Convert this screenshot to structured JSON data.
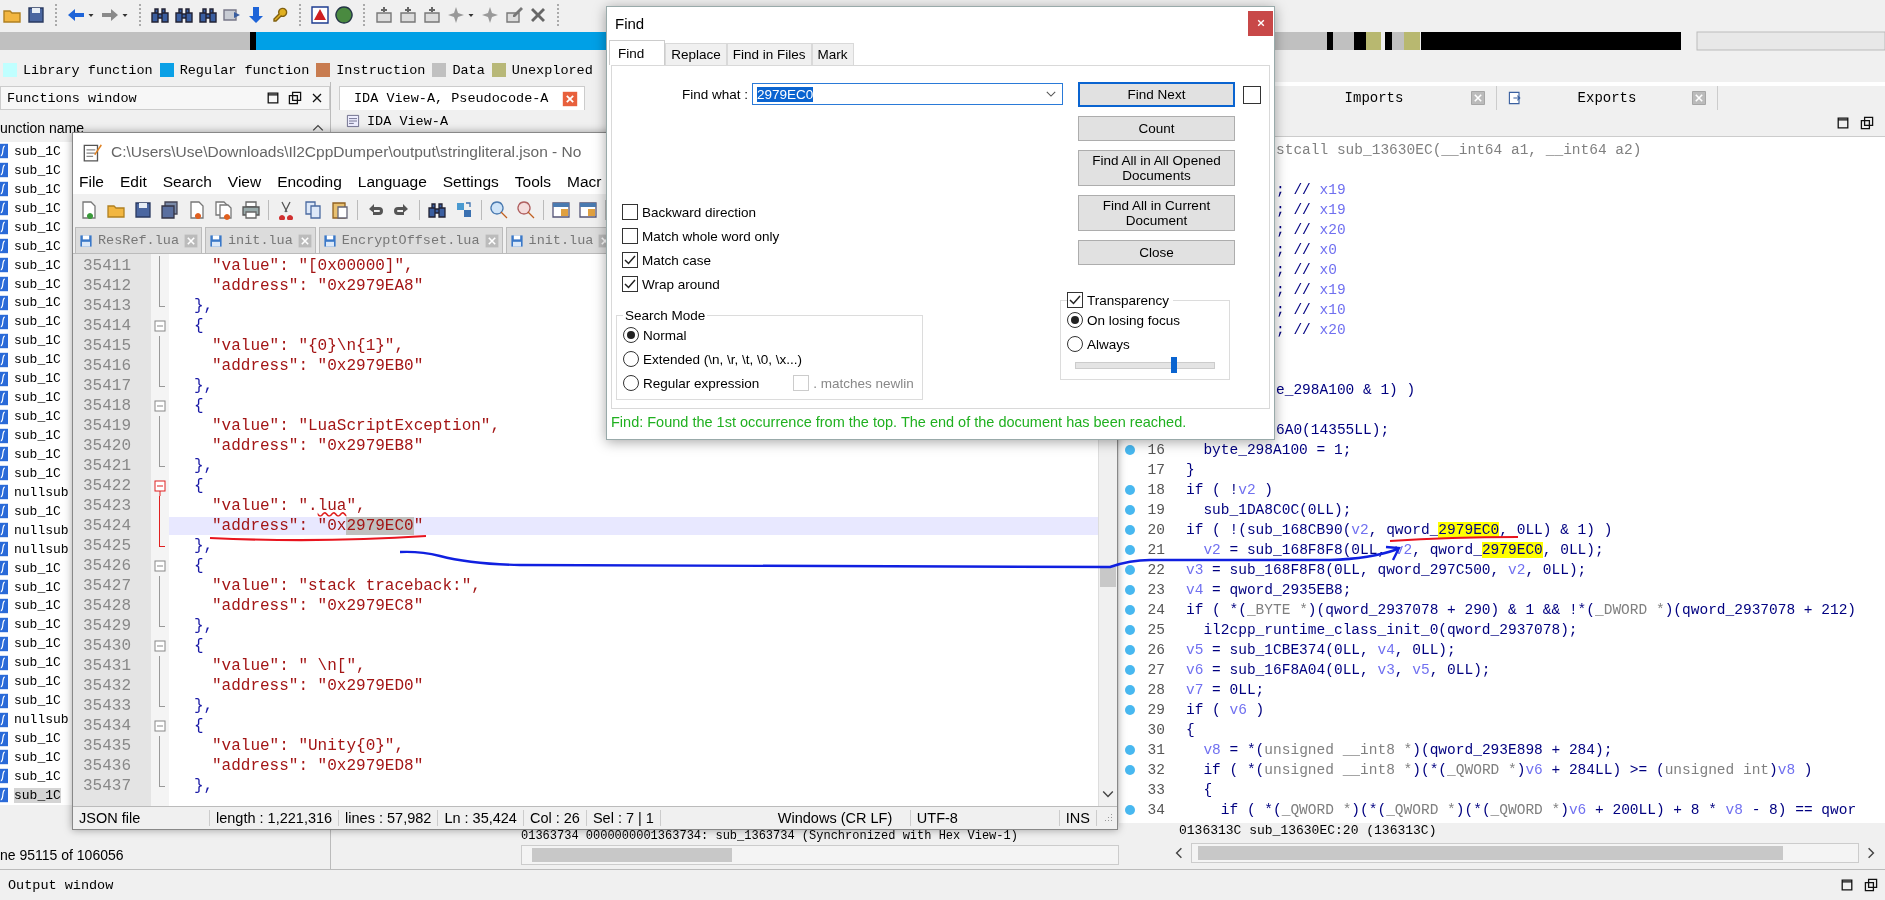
{
  "ida": {
    "legend": [
      {
        "label": "Library function",
        "color": "#c0ffff"
      },
      {
        "label": "Regular function",
        "color": "#0aa0e6"
      },
      {
        "label": "Instruction",
        "color": "#c87c50"
      },
      {
        "label": "Data",
        "color": "#c0c0c0"
      },
      {
        "label": "Unexplored",
        "color": "#b8b878"
      }
    ],
    "functions_window": {
      "title": "Functions window",
      "header": "unction name",
      "items": [
        {
          "name": "sub_1C",
          "selected": false
        },
        {
          "name": "sub_1C",
          "selected": false
        },
        {
          "name": "sub_1C",
          "selected": false
        },
        {
          "name": "sub_1C",
          "selected": false
        },
        {
          "name": "sub_1C",
          "selected": false
        },
        {
          "name": "sub_1C",
          "selected": false
        },
        {
          "name": "sub_1C",
          "selected": false
        },
        {
          "name": "sub_1C",
          "selected": false
        },
        {
          "name": "sub_1C",
          "selected": false
        },
        {
          "name": "sub_1C",
          "selected": false
        },
        {
          "name": "sub_1C",
          "selected": false
        },
        {
          "name": "sub_1C",
          "selected": false
        },
        {
          "name": "sub_1C",
          "selected": false
        },
        {
          "name": "sub_1C",
          "selected": false
        },
        {
          "name": "sub_1C",
          "selected": false
        },
        {
          "name": "sub_1C",
          "selected": false
        },
        {
          "name": "sub_1C",
          "selected": false
        },
        {
          "name": "sub_1C",
          "selected": false
        },
        {
          "name": "nullsub",
          "selected": false
        },
        {
          "name": "sub_1C",
          "selected": false
        },
        {
          "name": "nullsub",
          "selected": false
        },
        {
          "name": "nullsub",
          "selected": false
        },
        {
          "name": "sub_1C",
          "selected": false
        },
        {
          "name": "sub_1C",
          "selected": false
        },
        {
          "name": "sub_1C",
          "selected": false
        },
        {
          "name": "sub_1C",
          "selected": false
        },
        {
          "name": "sub_1C",
          "selected": false
        },
        {
          "name": "sub_1C",
          "selected": false
        },
        {
          "name": "sub_1C",
          "selected": false
        },
        {
          "name": "sub_1C",
          "selected": false
        },
        {
          "name": "nullsub",
          "selected": false
        },
        {
          "name": "sub_1C",
          "selected": false
        },
        {
          "name": "sub_1C",
          "selected": false
        },
        {
          "name": "sub_1C",
          "selected": false
        },
        {
          "name": "sub_1C",
          "selected": true
        }
      ],
      "status": "ne 95115 of 106056"
    },
    "view_tab": "IDA View-A, Pseudocode-A",
    "subview_tab": "IDA View-A",
    "sync_line": "01363734 0000000001363734: sub_1363734 (Synchronized with Hex View-1)",
    "side_tabs": [
      {
        "label": "Imports"
      },
      {
        "label": "Exports"
      }
    ],
    "pseudocode": {
      "lines": [
        {
          "kind": "tail",
          "parts": [
            {
              "text": "stcall sub_13630EC(__int64 a1, __int64 a2)",
              "kind": "type"
            }
          ]
        },
        {
          "kind": "covered"
        },
        {
          "kind": "tail",
          "parts": [
            {
              "text": "; // ",
              "kind": "plain"
            },
            {
              "text": "x19",
              "kind": "var"
            }
          ]
        },
        {
          "kind": "tail",
          "parts": [
            {
              "text": "; // ",
              "kind": "plain"
            },
            {
              "text": "x19",
              "kind": "var"
            }
          ]
        },
        {
          "kind": "tail",
          "parts": [
            {
              "text": "; // ",
              "kind": "plain"
            },
            {
              "text": "x20",
              "kind": "var"
            }
          ]
        },
        {
          "kind": "tail",
          "parts": [
            {
              "text": "; // ",
              "kind": "plain"
            },
            {
              "text": "x0",
              "kind": "var"
            }
          ]
        },
        {
          "kind": "tail",
          "parts": [
            {
              "text": "; // ",
              "kind": "plain"
            },
            {
              "text": "x0",
              "kind": "var"
            }
          ]
        },
        {
          "kind": "tail",
          "parts": [
            {
              "text": "; // ",
              "kind": "plain"
            },
            {
              "text": "x19",
              "kind": "var"
            }
          ]
        },
        {
          "kind": "tail",
          "parts": [
            {
              "text": "; // ",
              "kind": "plain"
            },
            {
              "text": "x10",
              "kind": "var"
            }
          ]
        },
        {
          "kind": "tail",
          "parts": [
            {
              "text": "; // ",
              "kind": "plain"
            },
            {
              "text": "x20",
              "kind": "var"
            }
          ]
        },
        {
          "kind": "covered"
        },
        {
          "kind": "covered"
        },
        {
          "kind": "tail",
          "parts": [
            {
              "text": "e_298A100 & 1) )",
              "kind": "plain"
            }
          ]
        },
        {
          "kind": "covered"
        },
        {
          "kind": "tail",
          "parts": [
            {
              "text": "6A0(14355LL);",
              "kind": "plain"
            }
          ]
        },
        {
          "kind": "line",
          "number": "16",
          "marker": true,
          "parts": [
            {
              "text": "  byte_298A100 = 1;",
              "kind": "plain"
            }
          ]
        },
        {
          "kind": "line",
          "number": "17",
          "marker": false,
          "parts": [
            {
              "text": "}",
              "kind": "plain"
            }
          ]
        },
        {
          "kind": "line",
          "number": "18",
          "marker": true,
          "parts": [
            {
              "text": "if ( !",
              "kind": "plain"
            },
            {
              "text": "v2",
              "kind": "var"
            },
            {
              "text": " )",
              "kind": "plain"
            }
          ]
        },
        {
          "kind": "line",
          "number": "19",
          "marker": true,
          "parts": [
            {
              "text": "  sub_1DA8C0C(0LL);",
              "kind": "plain"
            }
          ]
        },
        {
          "kind": "line",
          "number": "20",
          "marker": true,
          "parts": [
            {
              "text": "if ( !(sub_168CB90(",
              "kind": "plain"
            },
            {
              "text": "v2",
              "kind": "var"
            },
            {
              "text": ", qword_",
              "kind": "plain"
            },
            {
              "text": "2979EC0",
              "kind": "hl"
            },
            {
              "text": ", 0LL) & 1) )",
              "kind": "plain"
            }
          ]
        },
        {
          "kind": "line",
          "number": "21",
          "marker": true,
          "parts": [
            {
              "text": "  v2",
              "kind": "var"
            },
            {
              "text": " = sub_168F8F8(0LL, ",
              "kind": "plain"
            },
            {
              "text": "v2",
              "kind": "var"
            },
            {
              "text": ", qword_",
              "kind": "plain"
            },
            {
              "text": "2979EC0",
              "kind": "hl"
            },
            {
              "text": ", 0LL);",
              "kind": "plain"
            }
          ]
        },
        {
          "kind": "line",
          "number": "22",
          "marker": true,
          "parts": [
            {
              "text": "v3",
              "kind": "var"
            },
            {
              "text": " = sub_168F8F8(0LL, qword_297C500, ",
              "kind": "plain"
            },
            {
              "text": "v2",
              "kind": "var"
            },
            {
              "text": ", 0LL);",
              "kind": "plain"
            }
          ]
        },
        {
          "kind": "line",
          "number": "23",
          "marker": true,
          "parts": [
            {
              "text": "v4",
              "kind": "var"
            },
            {
              "text": " = qword_2935EB8;",
              "kind": "plain"
            }
          ]
        },
        {
          "kind": "line",
          "number": "24",
          "marker": true,
          "parts": [
            {
              "text": "if ( *(",
              "kind": "plain"
            },
            {
              "text": "_BYTE *",
              "kind": "type"
            },
            {
              "text": ")(qword_2937078 + 290) & 1 && !*(",
              "kind": "plain"
            },
            {
              "text": "_DWORD *",
              "kind": "type"
            },
            {
              "text": ")(qword_2937078 + 212)",
              "kind": "plain"
            }
          ]
        },
        {
          "kind": "line",
          "number": "25",
          "marker": true,
          "parts": [
            {
              "text": "  il2cpp_runtime_class_init_0(qword_2937078);",
              "kind": "plain"
            }
          ]
        },
        {
          "kind": "line",
          "number": "26",
          "marker": true,
          "parts": [
            {
              "text": "v5",
              "kind": "var"
            },
            {
              "text": " = sub_1CBE374(0LL, ",
              "kind": "plain"
            },
            {
              "text": "v4",
              "kind": "var"
            },
            {
              "text": ", 0LL);",
              "kind": "plain"
            }
          ]
        },
        {
          "kind": "line",
          "number": "27",
          "marker": true,
          "parts": [
            {
              "text": "v6",
              "kind": "var"
            },
            {
              "text": " = sub_16F8A04(0LL, ",
              "kind": "plain"
            },
            {
              "text": "v3",
              "kind": "var"
            },
            {
              "text": ", ",
              "kind": "plain"
            },
            {
              "text": "v5",
              "kind": "var"
            },
            {
              "text": ", 0LL);",
              "kind": "plain"
            }
          ]
        },
        {
          "kind": "line",
          "number": "28",
          "marker": true,
          "parts": [
            {
              "text": "v7",
              "kind": "var"
            },
            {
              "text": " = 0LL;",
              "kind": "plain"
            }
          ]
        },
        {
          "kind": "line",
          "number": "29",
          "marker": true,
          "parts": [
            {
              "text": "if ( ",
              "kind": "plain"
            },
            {
              "text": "v6",
              "kind": "var"
            },
            {
              "text": " )",
              "kind": "plain"
            }
          ]
        },
        {
          "kind": "line",
          "number": "30",
          "marker": false,
          "parts": [
            {
              "text": "{",
              "kind": "plain"
            }
          ]
        },
        {
          "kind": "line",
          "number": "31",
          "marker": true,
          "parts": [
            {
              "text": "  v8",
              "kind": "var"
            },
            {
              "text": " = *(",
              "kind": "plain"
            },
            {
              "text": "unsigned __int8 *",
              "kind": "type"
            },
            {
              "text": ")(qword_293E898 + 284);",
              "kind": "plain"
            }
          ]
        },
        {
          "kind": "line",
          "number": "32",
          "marker": true,
          "parts": [
            {
              "text": "  if ( *(",
              "kind": "plain"
            },
            {
              "text": "unsigned __int8 *",
              "kind": "type"
            },
            {
              "text": ")(*(",
              "kind": "plain"
            },
            {
              "text": "_QWORD *",
              "kind": "type"
            },
            {
              "text": ")",
              "kind": "plain"
            },
            {
              "text": "v6",
              "kind": "var"
            },
            {
              "text": " + 284LL) >= (",
              "kind": "plain"
            },
            {
              "text": "unsigned int",
              "kind": "type"
            },
            {
              "text": ")",
              "kind": "plain"
            },
            {
              "text": "v8",
              "kind": "var"
            },
            {
              "text": " )",
              "kind": "plain"
            }
          ]
        },
        {
          "kind": "line",
          "number": "33",
          "marker": false,
          "parts": [
            {
              "text": "  {",
              "kind": "plain"
            }
          ]
        },
        {
          "kind": "line",
          "number": "34",
          "marker": true,
          "parts": [
            {
              "text": "    if ( *(",
              "kind": "plain"
            },
            {
              "text": "_QWORD *",
              "kind": "type"
            },
            {
              "text": ")(*(",
              "kind": "plain"
            },
            {
              "text": "_QWORD *",
              "kind": "type"
            },
            {
              "text": ")(*(",
              "kind": "plain"
            },
            {
              "text": "_QWORD *",
              "kind": "type"
            },
            {
              "text": ")",
              "kind": "plain"
            },
            {
              "text": "v6",
              "kind": "var"
            },
            {
              "text": " + 200LL) + 8 * ",
              "kind": "plain"
            },
            {
              "text": "v8",
              "kind": "var"
            },
            {
              "text": " - 8) == qwor",
              "kind": "plain"
            }
          ]
        }
      ],
      "status": "0136313C sub_13630EC:20 (136313C)"
    },
    "output_window": {
      "title": "Output window"
    }
  },
  "notepad": {
    "title": "C:\\Users\\Use\\Downloads\\Il2CppDumper\\output\\stringliteral.json - No",
    "menu": [
      "File",
      "Edit",
      "Search",
      "View",
      "Encoding",
      "Language",
      "Settings",
      "Tools",
      "Macr"
    ],
    "tabs": [
      {
        "label": "ResRef.lua",
        "selected": false
      },
      {
        "label": "init.lua",
        "selected": false
      },
      {
        "label": "EncryptOffset.lua",
        "selected": false
      },
      {
        "label": "init.lua",
        "selected": false
      }
    ],
    "lines": [
      {
        "number": "35411",
        "kind": "pair",
        "fold_active": false,
        "current": false,
        "text": "\"value\": \"[0x00000]\","
      },
      {
        "number": "35412",
        "kind": "pair",
        "fold_active": false,
        "current": false,
        "text": "\"address\": \"0x2979EA8\""
      },
      {
        "number": "35413",
        "kind": "close",
        "fold_active": false,
        "current": false,
        "text": "},"
      },
      {
        "number": "35414",
        "kind": "open",
        "fold_active": false,
        "current": false,
        "text": "{"
      },
      {
        "number": "35415",
        "kind": "pair",
        "fold_active": false,
        "current": false,
        "text": "\"value\": \"{0}\\n{1}\","
      },
      {
        "number": "35416",
        "kind": "pair",
        "fold_active": false,
        "current": false,
        "text": "\"address\": \"0x2979EB0\""
      },
      {
        "number": "35417",
        "kind": "close",
        "fold_active": false,
        "current": false,
        "text": "},"
      },
      {
        "number": "35418",
        "kind": "open",
        "fold_active": false,
        "current": false,
        "text": "{"
      },
      {
        "number": "35419",
        "kind": "pair",
        "fold_active": false,
        "current": false,
        "text": "\"value\": \"LuaScriptException\","
      },
      {
        "number": "35420",
        "kind": "pair",
        "fold_active": false,
        "current": false,
        "text": "\"address\": \"0x2979EB8\""
      },
      {
        "number": "35421",
        "kind": "close",
        "fold_active": false,
        "current": false,
        "text": "},"
      },
      {
        "number": "35422",
        "kind": "open",
        "fold_active": true,
        "current": false,
        "text": "{"
      },
      {
        "number": "35423",
        "kind": "pair",
        "fold_active": true,
        "current": false,
        "parts": [
          {
            "text": "\"value\": \".",
            "kind": "plain"
          },
          {
            "text": "lua",
            "kind": "misspelled"
          },
          {
            "text": "\",",
            "kind": "plain"
          }
        ]
      },
      {
        "number": "35424",
        "kind": "pair",
        "fold_active": true,
        "current": true,
        "parts": [
          {
            "text": "\"address\": \"0x",
            "kind": "plain"
          },
          {
            "text": "2979EC0",
            "kind": "selection"
          },
          {
            "text": "\"",
            "kind": "plain"
          }
        ]
      },
      {
        "number": "35425",
        "kind": "close",
        "fold_active": true,
        "current": false,
        "text": "},"
      },
      {
        "number": "35426",
        "kind": "open",
        "fold_active": false,
        "current": false,
        "text": "{"
      },
      {
        "number": "35427",
        "kind": "pair",
        "fold_active": false,
        "current": false,
        "text": "\"value\": \"stack traceback:\","
      },
      {
        "number": "35428",
        "kind": "pair",
        "fold_active": false,
        "current": false,
        "text": "\"address\": \"0x2979EC8\""
      },
      {
        "number": "35429",
        "kind": "close",
        "fold_active": false,
        "current": false,
        "text": "},"
      },
      {
        "number": "35430",
        "kind": "open",
        "fold_active": false,
        "current": false,
        "text": "{"
      },
      {
        "number": "35431",
        "kind": "pair",
        "fold_active": false,
        "current": false,
        "text": "\"value\": \" \\n[\","
      },
      {
        "number": "35432",
        "kind": "pair",
        "fold_active": false,
        "current": false,
        "text": "\"address\": \"0x2979ED0\""
      },
      {
        "number": "35433",
        "kind": "close",
        "fold_active": false,
        "current": false,
        "text": "},"
      },
      {
        "number": "35434",
        "kind": "open",
        "fold_active": false,
        "current": false,
        "text": "{"
      },
      {
        "number": "35435",
        "kind": "pair",
        "fold_active": false,
        "current": false,
        "text": "\"value\": \"Unity{0}\","
      },
      {
        "number": "35436",
        "kind": "pair",
        "fold_active": false,
        "current": false,
        "text": "\"address\": \"0x2979ED8\""
      },
      {
        "number": "35437",
        "kind": "close",
        "fold_active": false,
        "current": false,
        "text": "},"
      }
    ],
    "status_bar": {
      "left": [
        "JSON file",
        "length : 1,221,316",
        "lines : 57,982",
        "Ln : 35,424",
        "Col : 26",
        "Sel : 7 | 1"
      ],
      "right": [
        "Windows (CR LF)",
        "UTF-8",
        "INS"
      ]
    }
  },
  "find_dialog": {
    "title": "Find",
    "tabs": [
      {
        "label": "Find",
        "selected": true
      },
      {
        "label": "Replace",
        "selected": false
      },
      {
        "label": "Find in Files",
        "selected": false
      },
      {
        "label": "Mark",
        "selected": false
      }
    ],
    "find_what": {
      "label": "Find what :",
      "value": "2979EC0"
    },
    "buttons": [
      {
        "label": "Find Next",
        "default": true
      },
      {
        "label": "Count",
        "default": false
      },
      {
        "label": "Find All in All Opened Documents",
        "default": false
      },
      {
        "label": "Find All in Current Document",
        "default": false
      },
      {
        "label": "Close",
        "default": false
      }
    ],
    "side_checkbox": {
      "checked": false
    },
    "options": [
      {
        "label": "Backward direction",
        "checked": false
      },
      {
        "label": "Match whole word only",
        "checked": false
      },
      {
        "label": "Match case",
        "checked": true
      },
      {
        "label": "Wrap around",
        "checked": true
      }
    ],
    "search_mode": {
      "title": "Search Mode",
      "modes": [
        {
          "label": "Normal",
          "selected": true
        },
        {
          "label": "Extended (\\n, \\r, \\t, \\0, \\x...)",
          "selected": false
        },
        {
          "label": "Regular expression",
          "selected": false
        }
      ],
      "newline_option": {
        "label": ". matches newlin",
        "checked": false,
        "disabled": true
      }
    },
    "transparency": {
      "label": "Transparency",
      "checked": true,
      "modes": [
        {
          "label": "On losing focus",
          "selected": true
        },
        {
          "label": "Always",
          "selected": false
        }
      ],
      "level": 0.71
    },
    "status": "Find: Found the 1st occurrence from the top. The end of the document has been reached."
  }
}
